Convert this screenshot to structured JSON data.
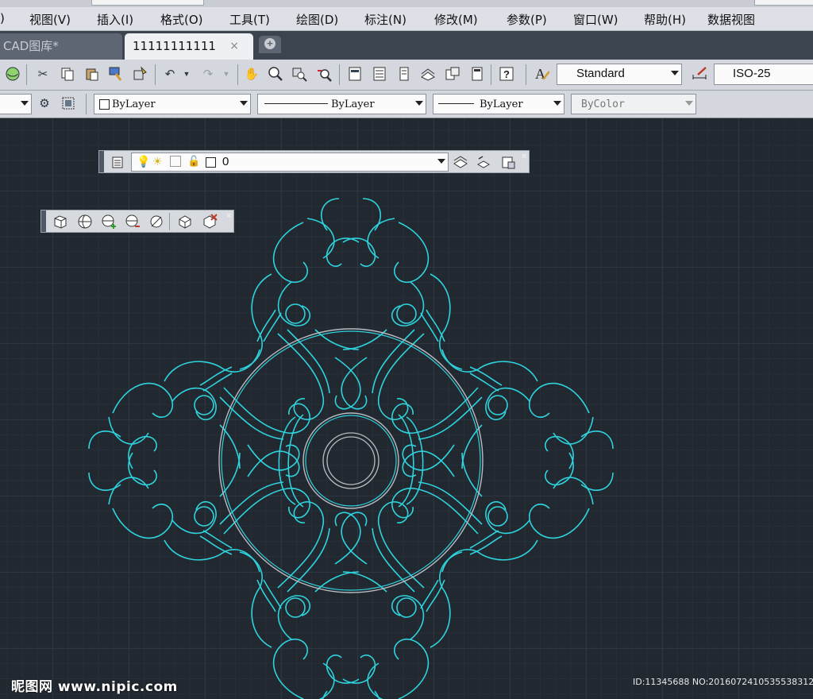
{
  "menubar": {
    "items": [
      ")",
      "视图(V)",
      "插入(I)",
      "格式(O)",
      "工具(T)",
      "绘图(D)",
      "标注(N)",
      "修改(M)",
      "参数(P)",
      "窗口(W)",
      "帮助(H)",
      "数据视图"
    ]
  },
  "tabs": {
    "items": [
      {
        "label": "CAD图库*",
        "active": false
      },
      {
        "label": "11111111111",
        "active": true
      }
    ],
    "close_glyph": "×"
  },
  "toolbar1": {
    "text_style": "Standard",
    "dim_style": "ISO-25"
  },
  "toolbar2": {
    "color": "ByLayer",
    "linetype": "ByLayer",
    "lineweight": "ByLayer",
    "plotstyle": "ByColor"
  },
  "layer_toolbar": {
    "current_layer": "0"
  },
  "icons": [
    "3d-orbit-icon",
    "cut-icon",
    "copy-icon",
    "paste-icon",
    "match-properties-icon",
    "block-editor-icon",
    "undo-icon",
    "redo-icon",
    "pan-icon",
    "zoom-realtime-icon",
    "zoom-window-icon",
    "zoom-previous-icon",
    "properties-icon",
    "design-center-icon",
    "tool-palettes-icon",
    "sheet-set-icon",
    "markup-icon",
    "calculator-icon",
    "help-icon",
    "text-style-icon",
    "dim-style-icon",
    "layer-manager-icon",
    "layer-state-icon"
  ],
  "colors": {
    "canvas_bg": "#212830",
    "ornament": "#2fd3dd",
    "circles": "#b9bcc0"
  },
  "watermark": {
    "left": "昵图网 www.nipic.com",
    "right": "ID:11345688 NO:20160724105355383122"
  }
}
